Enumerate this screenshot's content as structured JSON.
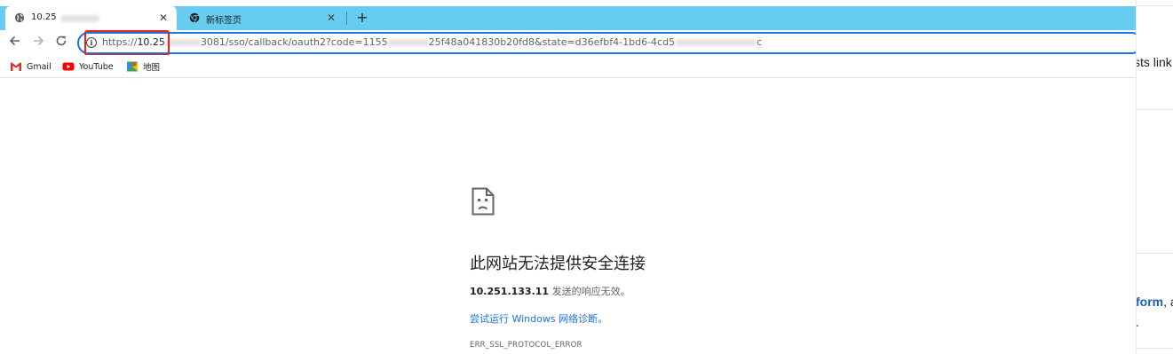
{
  "tabs": [
    {
      "title": "10.25",
      "favicon": "globe-icon",
      "close": "✕",
      "active": true
    },
    {
      "title": "新标签页",
      "favicon": "chrome-icon",
      "close": "✕",
      "active": false
    }
  ],
  "new_tab": "+",
  "toolbar": {
    "back": "back-arrow-icon",
    "forward": "forward-arrow-icon",
    "reload": "reload-icon"
  },
  "address_bar": {
    "info_icon": "i",
    "url_scheme": "https://",
    "url_host_visible": "10.25",
    "url_rest_start": "3081/sso/callback/oauth2?code=1155",
    "url_rest_mid": "25f48a041830b20fd8&state=d36efbf4-1bd6-4cd5",
    "url_rest_end": "c"
  },
  "bookmarks": [
    {
      "label": "Gmail",
      "icon": "gmail-icon"
    },
    {
      "label": "YouTube",
      "icon": "youtube-icon"
    },
    {
      "label": "地图",
      "icon": "maps-icon"
    }
  ],
  "error_page": {
    "icon": "sad-page-icon",
    "title": "此网站无法提供安全连接",
    "host": "10.251.133.11",
    "detail_suffix": " 发送的响应无效。",
    "diagnose_link": "尝试运行 Windows 网络诊断。",
    "error_code": "ERR_SSL_PROTOCOL_ERROR"
  },
  "background_page": {
    "text_1": "sts link",
    "link_text": "form",
    "after_link": ", a",
    "dot": "."
  },
  "colors": {
    "tab_strip": "#66ccf0",
    "omnibox_focus": "#1a73e8",
    "highlight": "#e8211c",
    "link": "#1a73e8"
  }
}
